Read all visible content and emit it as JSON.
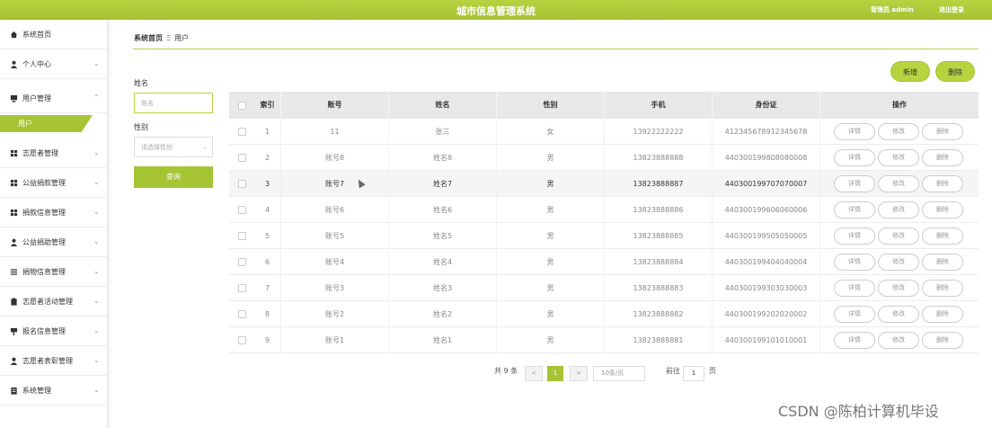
{
  "header": {
    "title": "城市信息管理系统",
    "admin": "管理员 admin",
    "logout": "退出登录"
  },
  "sidebar": {
    "items": [
      {
        "label": "系统首页",
        "icon": "home-icon",
        "chev": ""
      },
      {
        "label": "个人中心",
        "icon": "user-icon",
        "chev": "⌄"
      },
      {
        "label": "用户管理",
        "icon": "monitor-icon",
        "chev": "⌃"
      },
      {
        "label": "志愿者管理",
        "icon": "grid-icon",
        "chev": "⌄"
      },
      {
        "label": "公益捐款管理",
        "icon": "grid-icon",
        "chev": "⌄"
      },
      {
        "label": "捐款信息管理",
        "icon": "grid-icon",
        "chev": "⌄"
      },
      {
        "label": "公益捐助管理",
        "icon": "user-icon",
        "chev": "⌄"
      },
      {
        "label": "捐物信息管理",
        "icon": "list-icon",
        "chev": "⌄"
      },
      {
        "label": "志愿者活动管理",
        "icon": "clipboard-icon",
        "chev": "⌄"
      },
      {
        "label": "报名信息管理",
        "icon": "flag-icon",
        "chev": "⌄"
      },
      {
        "label": "志愿者表彰管理",
        "icon": "user-icon",
        "chev": "⌄"
      },
      {
        "label": "系统管理",
        "icon": "document-icon",
        "chev": "⌄"
      }
    ],
    "active_sub": "用户"
  },
  "breadcrumb": {
    "home": "系统首页",
    "sep": "Ξ",
    "current": "用户"
  },
  "search": {
    "name_label": "姓名",
    "name_placeholder": "姓名",
    "gender_label": "性别",
    "gender_placeholder": "请选择性别",
    "dropdown": "⌄",
    "query": "查询"
  },
  "actions": {
    "add": "新增",
    "delete": "删除"
  },
  "table": {
    "columns": [
      "索引",
      "账号",
      "姓名",
      "性别",
      "手机",
      "身份证",
      "操作"
    ],
    "rows": [
      {
        "idx": "1",
        "account": "11",
        "name": "张三",
        "gender": "女",
        "phone": "13922222222",
        "id": "412345678912345678"
      },
      {
        "idx": "2",
        "account": "账号8",
        "name": "姓名8",
        "gender": "男",
        "phone": "13823888888",
        "id": "440300199808080008"
      },
      {
        "idx": "3",
        "account": "账号7",
        "name": "姓名7",
        "gender": "男",
        "phone": "13823888887",
        "id": "440300199707070007"
      },
      {
        "idx": "4",
        "account": "账号6",
        "name": "姓名6",
        "gender": "男",
        "phone": "13823888886",
        "id": "440300199606060006"
      },
      {
        "idx": "5",
        "account": "账号5",
        "name": "姓名5",
        "gender": "男",
        "phone": "13823888885",
        "id": "440300199505050005"
      },
      {
        "idx": "6",
        "account": "账号4",
        "name": "姓名4",
        "gender": "男",
        "phone": "13823888884",
        "id": "440300199404040004"
      },
      {
        "idx": "7",
        "account": "账号3",
        "name": "姓名3",
        "gender": "男",
        "phone": "13823888883",
        "id": "440300199303030003"
      },
      {
        "idx": "8",
        "account": "账号2",
        "name": "姓名2",
        "gender": "男",
        "phone": "13823888882",
        "id": "440300199202020002"
      },
      {
        "idx": "9",
        "account": "账号1",
        "name": "姓名1",
        "gender": "男",
        "phone": "13823888881",
        "id": "440300199101010001"
      }
    ],
    "ops": [
      "详情",
      "修改",
      "删除"
    ]
  },
  "pager": {
    "total": "共 9 条",
    "prev": "<",
    "page": "1",
    "next": ">",
    "size": "10条/页",
    "goto": "前往",
    "goto_value": "1",
    "page_unit": "页"
  },
  "watermark": "CSDN @陈柏计算机毕设",
  "colors": {
    "accent": "#a5c434",
    "accent_light": "#b6d340"
  }
}
